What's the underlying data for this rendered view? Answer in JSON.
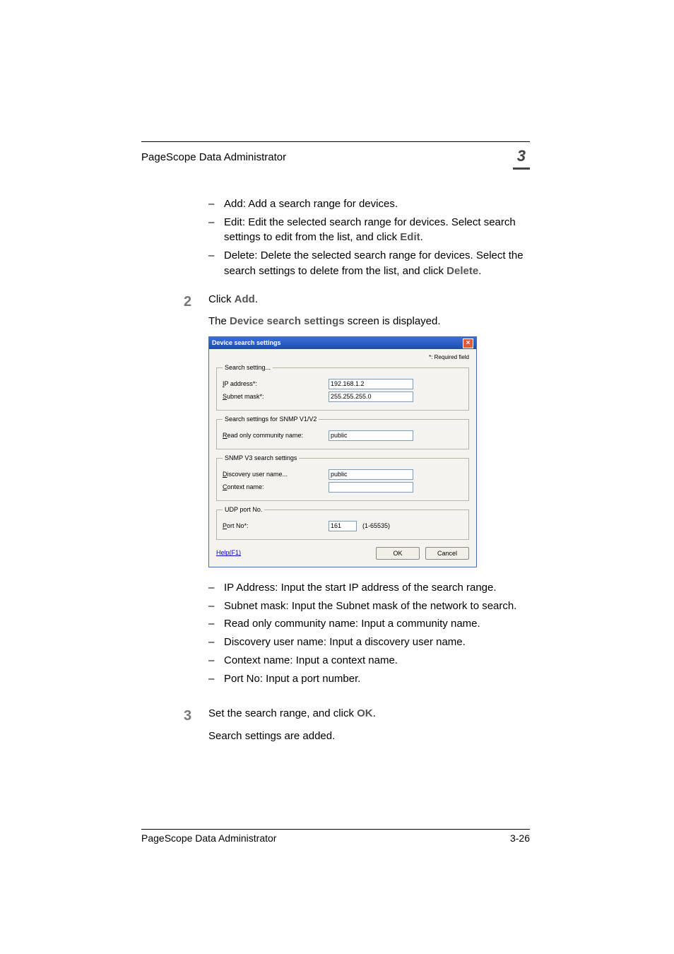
{
  "header": {
    "title": "PageScope Data Administrator",
    "chapter": "3"
  },
  "top_bullets": [
    {
      "prefix": "Add: ",
      "text": "Add a search range for devices."
    },
    {
      "prefix": "Edit: ",
      "text1": "Edit the selected search range for devices. Select search settings to edit from the list, and click ",
      "bold": "Edit",
      "text2": "."
    },
    {
      "prefix": "Delete: ",
      "text1": "Delete the selected search range for devices. Select the search settings to delete from the list, and click ",
      "bold": "Delete",
      "text2": "."
    }
  ],
  "step2": {
    "num": "2",
    "line1a": "Click ",
    "line1b": "Add",
    "line1c": ".",
    "line2a": "The ",
    "line2b": "Device search settings",
    "line2c": " screen is displayed."
  },
  "dialog": {
    "title": "Device search settings",
    "required": "*: Required field",
    "grp_search": "Search setting...",
    "lbl_ip": "IP address*:",
    "val_ip": "192.168.1.2",
    "lbl_subnet": "Subnet mask*:",
    "val_subnet": "255.255.255.0",
    "grp_snmpv1": "Search settings for SNMP V1/V2",
    "lbl_read": "Read only community name:",
    "val_read": "public",
    "grp_snmpv3": "SNMP V3 search settings",
    "lbl_disc": "Discovery user name...",
    "val_disc": "public",
    "lbl_ctx": "Context name:",
    "val_ctx": "",
    "grp_udp": "UDP port No.",
    "lbl_port": "Port No*:",
    "val_port": "161",
    "port_hint": "(1-65535)",
    "help": "Help(F1)",
    "ok": "OK",
    "cancel": "Cancel"
  },
  "mid_bullets": [
    "IP Address: Input the start IP address of the search range.",
    "Subnet mask: Input the Subnet mask of the network to search.",
    "Read only community name: Input a community name.",
    "Discovery user name: Input a discovery user name.",
    "Context name: Input a context name.",
    "Port No: Input a port number."
  ],
  "step3": {
    "num": "3",
    "line1a": "Set the search range, and click ",
    "line1b": "OK",
    "line1c": ".",
    "line2": "Search settings are added."
  },
  "footer": {
    "title": "PageScope Data Administrator",
    "page": "3-26"
  }
}
